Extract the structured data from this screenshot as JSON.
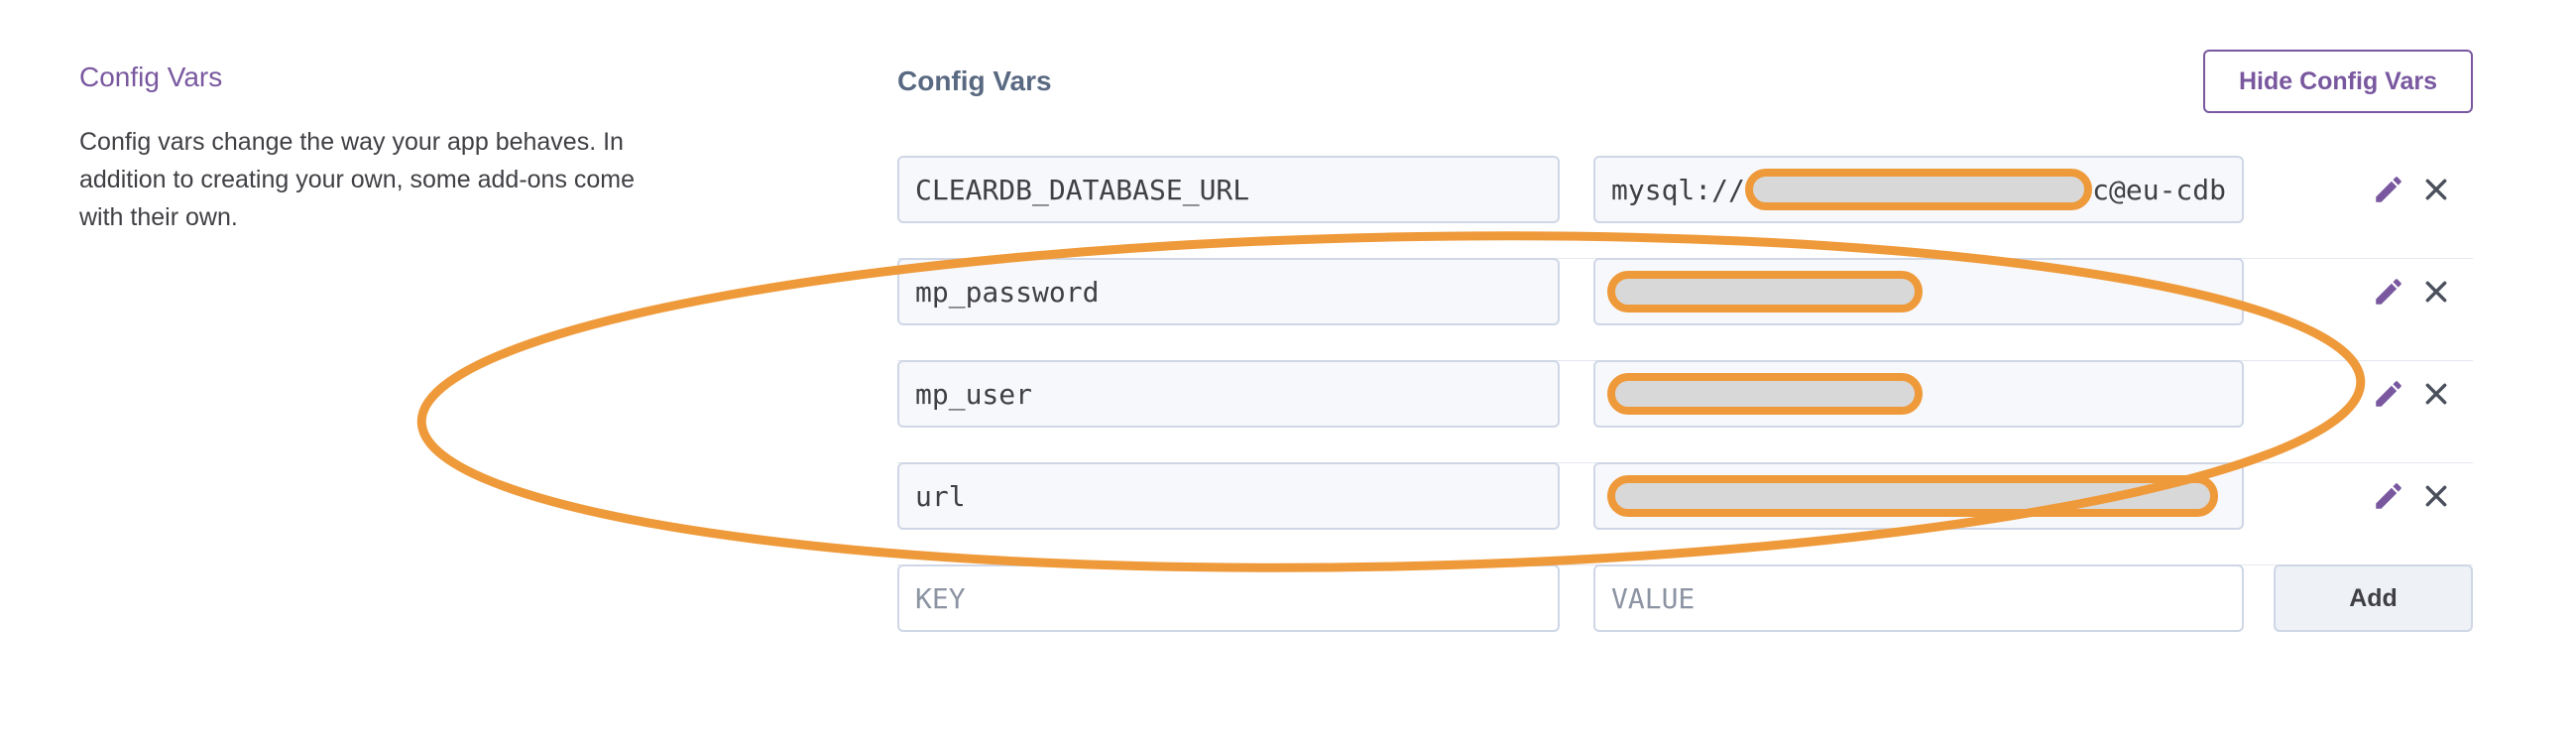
{
  "sidebar": {
    "heading": "Config Vars",
    "description": "Config vars change the way your app behaves. In addition to creating your own, some add-ons come with their own."
  },
  "main": {
    "heading": "Config Vars",
    "hide_button": "Hide Config Vars"
  },
  "vars": [
    {
      "key": "CLEARDB_DATABASE_URL",
      "value_prefix": "mysql://",
      "value_suffix": "c@eu-cdb"
    },
    {
      "key": "mp_password"
    },
    {
      "key": "mp_user"
    },
    {
      "key": "url"
    }
  ],
  "new_var": {
    "key_placeholder": "KEY",
    "value_placeholder": "VALUE",
    "add_label": "Add"
  },
  "icons": {
    "edit": "pencil-icon",
    "remove": "close-icon"
  },
  "colors": {
    "accent": "#79589f",
    "annotation": "#ef9a3a",
    "redaction": "#d8d8d8"
  }
}
